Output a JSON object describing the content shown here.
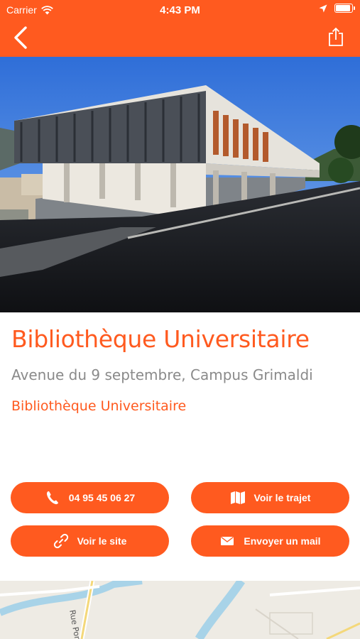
{
  "status_bar": {
    "carrier": "Carrier",
    "time": "4:43 PM"
  },
  "colors": {
    "accent": "#ff5a1f",
    "address_gray": "#8a8a8a"
  },
  "nav": {
    "back_icon": "chevron-left-icon",
    "share_icon": "share-icon"
  },
  "place": {
    "title": "Bibliothèque Universitaire",
    "address": "Avenue du 9 septembre, Campus Grimaldi",
    "category": "Bibliothèque Universitaire"
  },
  "actions": {
    "phone_label": "04 95 45 06 27",
    "route_label": "Voir le trajet",
    "site_label": "Voir le site",
    "mail_label": "Envoyer un mail"
  },
  "map": {
    "street_label": "Rue Pon"
  }
}
